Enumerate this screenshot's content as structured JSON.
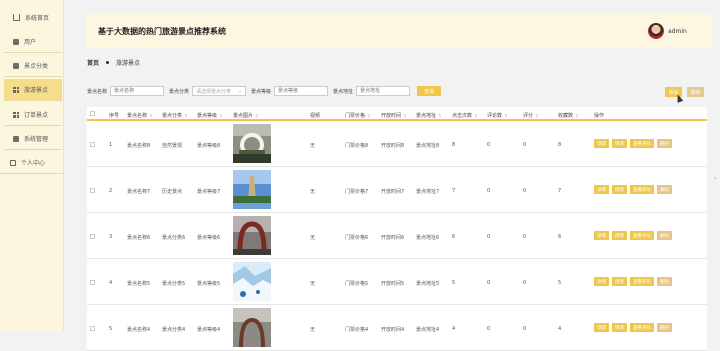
{
  "sidebar": {
    "items": [
      {
        "label": "系统首页",
        "icon": "home-icon"
      },
      {
        "label": "用户",
        "icon": "user-list-icon"
      },
      {
        "label": "景点分类",
        "icon": "category-icon"
      },
      {
        "label": "旅游景点",
        "icon": "grid-icon"
      },
      {
        "label": "订单景点",
        "icon": "grid-icon"
      },
      {
        "label": "系统管理",
        "icon": "settings-icon"
      },
      {
        "label": "个人中心",
        "icon": "profile-icon"
      }
    ]
  },
  "header": {
    "title": "基于大数据的热门旅游景点推荐系统",
    "user": "admin"
  },
  "breadcrumb": {
    "home": "首页",
    "current": "旅游景点"
  },
  "search": {
    "name_label": "景点名称",
    "name_placeholder": "景点名称",
    "category_label": "景点分类",
    "category_placeholder": "请选择景点分类",
    "level_label": "景点等级",
    "level_placeholder": "景点等级",
    "address_label": "景点地址",
    "address_placeholder": "景点地址",
    "query_button": "查询"
  },
  "toolbar": {
    "add": "添加",
    "delete": "删除"
  },
  "table": {
    "headers": [
      "序号",
      "景点名称",
      "景点分类",
      "景点等级",
      "景点图片",
      "视频",
      "门票价格",
      "开放时间",
      "景点地址",
      "点击次数",
      "评论数",
      "评分",
      "收藏数",
      "操作"
    ],
    "rows": [
      {
        "no": "1",
        "name": "景点名称8",
        "category": "自然景观",
        "level": "景点等级8",
        "video": "无",
        "price": "门票价格8",
        "open": "开放时间8",
        "address": "景点地址8",
        "clicks": "8",
        "comments": "0",
        "score": "0",
        "favorites": "8"
      },
      {
        "no": "2",
        "name": "景点名称7",
        "category": "历史景点",
        "level": "景点等级7",
        "video": "无",
        "price": "门票价格7",
        "open": "开放时间7",
        "address": "景点地址7",
        "clicks": "7",
        "comments": "0",
        "score": "0",
        "favorites": "7"
      },
      {
        "no": "3",
        "name": "景点名称6",
        "category": "景点分类6",
        "level": "景点等级6",
        "video": "无",
        "price": "门票价格6",
        "open": "开放时间6",
        "address": "景点地址6",
        "clicks": "6",
        "comments": "0",
        "score": "0",
        "favorites": "6"
      },
      {
        "no": "4",
        "name": "景点名称5",
        "category": "景点分类5",
        "level": "景点等级5",
        "video": "无",
        "price": "门票价格5",
        "open": "开放时间5",
        "address": "景点地址5",
        "clicks": "5",
        "comments": "0",
        "score": "0",
        "favorites": "5"
      },
      {
        "no": "5",
        "name": "景点名称4",
        "category": "景点分类4",
        "level": "景点等级4",
        "video": "无",
        "price": "门票价格4",
        "open": "开放时间4",
        "address": "景点地址4",
        "clicks": "4",
        "comments": "0",
        "score": "0",
        "favorites": "4"
      }
    ],
    "ops": [
      "详情",
      "修改",
      "查看评论",
      "删除"
    ]
  },
  "colors": {
    "accent": "#f0c74b",
    "sidebar_bg": "#fdf6df",
    "header_bg": "#fdf7e2"
  }
}
